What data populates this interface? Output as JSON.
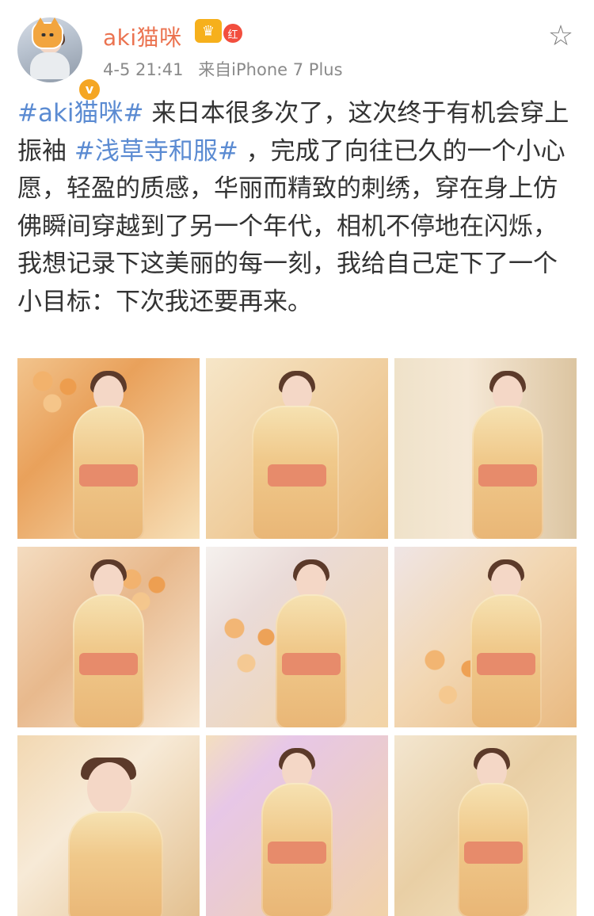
{
  "post": {
    "username": "aki猫咪",
    "badge_red_label": "红",
    "timestamp": "4-5 21:41",
    "source": "来自iPhone 7 Plus",
    "text_segments": [
      {
        "text": "#aki猫咪#",
        "type": "tag"
      },
      {
        "text": "来日本很多次了，这次终于有机会穿上振袖",
        "type": "plain"
      },
      {
        "text": "#浅草寺和服#",
        "type": "tag"
      },
      {
        "text": "，完成了向往已久的一个小心愿，轻盈的质感，华丽而精致的刺绣，穿在身上仿佛瞬间穿越到了另一个年代，相机不停地在闪烁，我想记录下这美丽的每一刻，我给自己定下了一个小目标：下次我还要再来。",
        "type": "plain"
      }
    ],
    "icons": {
      "avatar_badge": "cat-badge-icon",
      "verified": "verified-v-icon",
      "vip": "crown-icon",
      "favorite": "star-outline-icon"
    },
    "colors": {
      "username": "#eb7350",
      "tag": "#5b8bd2",
      "meta": "#8a8a8a",
      "text": "#333333"
    },
    "images": [
      {
        "name": "photo-1",
        "theme": "kimono-portrait"
      },
      {
        "name": "photo-2",
        "theme": "kimono-portrait"
      },
      {
        "name": "photo-3",
        "theme": "kimono-portrait"
      },
      {
        "name": "photo-4",
        "theme": "kimono-portrait"
      },
      {
        "name": "photo-5",
        "theme": "kimono-portrait"
      },
      {
        "name": "photo-6",
        "theme": "kimono-portrait"
      },
      {
        "name": "photo-7",
        "theme": "kimono-portrait"
      },
      {
        "name": "photo-8",
        "theme": "kimono-portrait"
      },
      {
        "name": "photo-9",
        "theme": "kimono-portrait"
      }
    ]
  }
}
